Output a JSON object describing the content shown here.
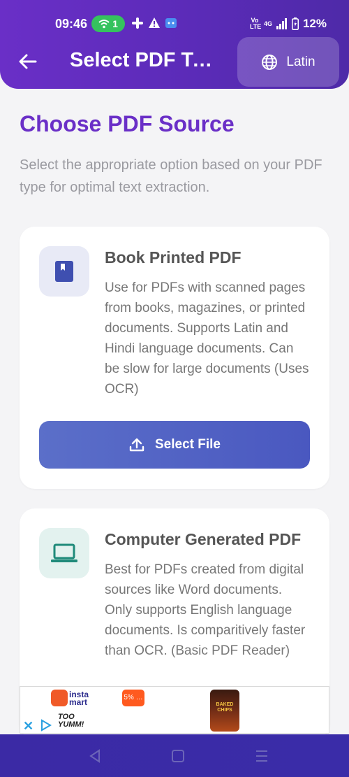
{
  "status": {
    "time": "09:46",
    "hotspot_count": "1",
    "network_label": "Vo LTE",
    "signal_label": "4G",
    "battery": "12%"
  },
  "appbar": {
    "title": "Select PDF Ty…",
    "language_button": "Latin"
  },
  "page": {
    "title": "Choose PDF Source",
    "description": "Select the appropriate option based on your PDF type for optimal text extraction."
  },
  "cards": [
    {
      "title": "Book Printed PDF",
      "description": "Use for PDFs with scanned pages from books, magazines, or printed documents. Supports Latin and Hindi language documents. Can be slow for large documents (Uses OCR)",
      "button_label": "Select File",
      "icon": "book-icon",
      "icon_color": "#3f4fb0",
      "icon_bg": "#e8eaf6"
    },
    {
      "title": "Computer Generated PDF",
      "description": "Best for PDFs created from digital sources like Word documents. Only supports English language documents. Is comparitively faster than OCR. (Basic PDF Reader)",
      "icon": "laptop-icon",
      "icon_color": "#1f8a7a",
      "icon_bg": "#e3f2ef"
    }
  ],
  "ad": {
    "brand": "insta mart",
    "tagline": "TOO YUMM!",
    "badge": "5% …",
    "product": "BAKED CHIPS"
  },
  "colors": {
    "primary": "#6a2fc7",
    "button": "#4a58c0",
    "navbar": "#3b2aa5"
  }
}
